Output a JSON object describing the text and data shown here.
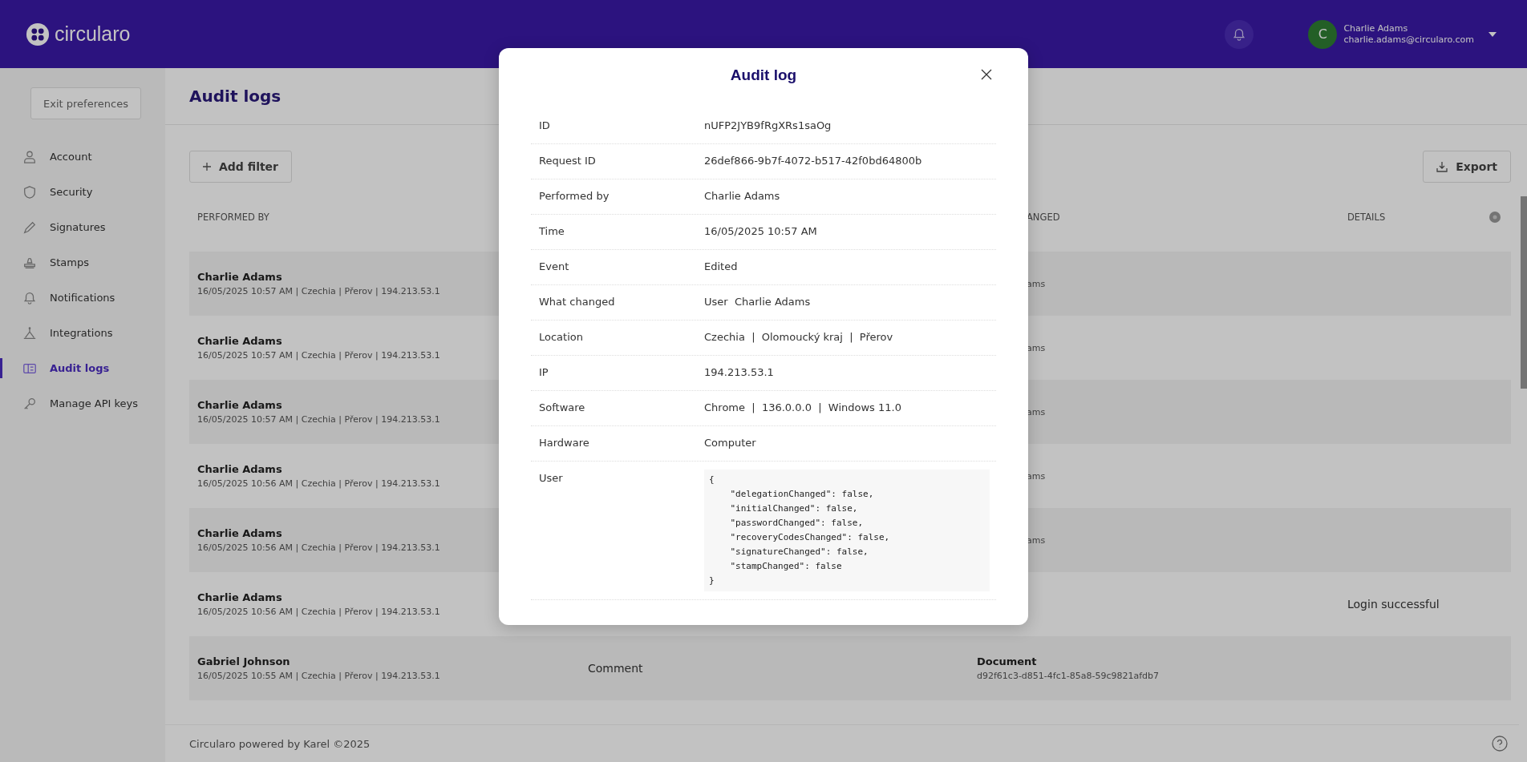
{
  "header": {
    "logo": "circularo",
    "user": {
      "initial": "C",
      "name": "Charlie Adams",
      "email": "charlie.adams@circularo.com"
    }
  },
  "sidebar": {
    "exit_button": "Exit preferences",
    "items": [
      {
        "label": "Account",
        "selected": false
      },
      {
        "label": "Security",
        "selected": false
      },
      {
        "label": "Signatures",
        "selected": false
      },
      {
        "label": "Stamps",
        "selected": false
      },
      {
        "label": "Notifications",
        "selected": false
      },
      {
        "label": "Integrations",
        "selected": false
      },
      {
        "label": "Audit logs",
        "selected": true
      },
      {
        "label": "Manage API keys",
        "selected": false
      }
    ]
  },
  "main": {
    "title": "Audit logs",
    "add_filter": "Add filter",
    "export": "Export",
    "columns": [
      "PERFORMED BY",
      "ANGED",
      "DETAILS"
    ],
    "rows": [
      {
        "name": "Charlie Adams",
        "meta": "16/05/2025 10:57 AM | Czechia | Přerov | 194.213.53.1",
        "what_changed": "ams"
      },
      {
        "name": "Charlie Adams",
        "meta": "16/05/2025 10:57 AM | Czechia | Přerov | 194.213.53.1",
        "what_changed": "ams"
      },
      {
        "name": "Charlie Adams",
        "meta": "16/05/2025 10:57 AM | Czechia | Přerov | 194.213.53.1",
        "what_changed": "ams"
      },
      {
        "name": "Charlie Adams",
        "meta": "16/05/2025 10:56 AM | Czechia | Přerov | 194.213.53.1",
        "what_changed": "ams"
      },
      {
        "name": "Charlie Adams",
        "meta": "16/05/2025 10:56 AM | Czechia | Přerov | 194.213.53.1",
        "what_changed": "ams"
      },
      {
        "name": "Charlie Adams",
        "meta": "16/05/2025 10:56 AM | Czechia | Přerov | 194.213.53.1",
        "details": "Login successful"
      },
      {
        "name": "Gabriel Johnson",
        "meta": "16/05/2025 10:55 AM | Czechia | Přerov | 194.213.53.1",
        "event": "Comment",
        "object": "Document",
        "object_id": "d92f61c3-d851-4fc1-85a8-59c9821afdb7"
      }
    ]
  },
  "footer": {
    "text": "Circularo powered by Karel ©2025"
  },
  "modal": {
    "title": "Audit log",
    "fields": [
      {
        "label": "ID",
        "value": "nUFP2JYB9fRgXRs1saOg",
        "kind": "text"
      },
      {
        "label": "Request ID",
        "value": "26def866-9b7f-4072-b517-42f0bd64800b",
        "kind": "text"
      },
      {
        "label": "Performed by",
        "value": "Charlie Adams",
        "kind": "text"
      },
      {
        "label": "Time",
        "value": "16/05/2025 10:57 AM",
        "kind": "text"
      },
      {
        "label": "Event",
        "value": "Edited",
        "kind": "text"
      },
      {
        "label": "What changed",
        "value": "User  Charlie Adams",
        "kind": "text"
      },
      {
        "label": "Location",
        "value": "Czechia  |  Olomoucký kraj  |  Přerov",
        "kind": "text"
      },
      {
        "label": "IP",
        "value": "194.213.53.1",
        "kind": "text"
      },
      {
        "label": "Software",
        "value": "Chrome  |  136.0.0.0  |  Windows 11.0",
        "kind": "text"
      },
      {
        "label": "Hardware",
        "value": "Computer",
        "kind": "text"
      },
      {
        "label": "User",
        "value": "{\n    \"delegationChanged\": false,\n    \"initialChanged\": false,\n    \"passwordChanged\": false,\n    \"recoveryCodesChanged\": false,\n    \"signatureChanged\": false,\n    \"stampChanged\": false\n}",
        "kind": "code"
      }
    ]
  }
}
